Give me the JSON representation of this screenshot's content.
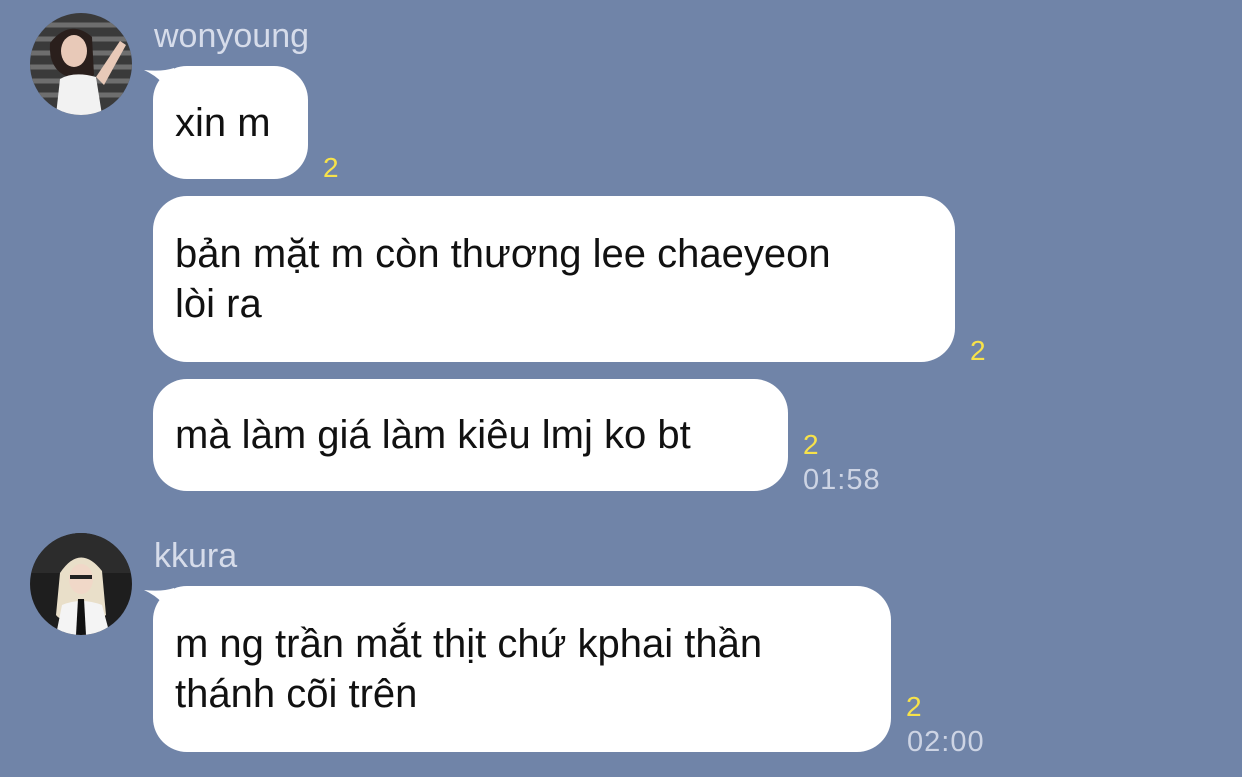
{
  "colors": {
    "background": "#7084a8",
    "bubble": "#ffffff",
    "read_count": "#f7e24a",
    "meta_text": "#cdd4e4"
  },
  "groups": [
    {
      "sender": "wonyoung",
      "avatar_icon": "profile-photo",
      "messages": [
        {
          "text": "xin m",
          "read_count": "2",
          "time": ""
        },
        {
          "text": "bản mặt m còn thương lee chaeyeon\nlòi ra",
          "read_count": "2",
          "time": ""
        },
        {
          "text": "mà làm giá làm kiêu lmj ko bt",
          "read_count": "2",
          "time": "01:58"
        }
      ]
    },
    {
      "sender": "kkura",
      "avatar_icon": "profile-photo",
      "messages": [
        {
          "text": "m ng trần mắt thịt chứ kphai thần\nthánh cõi trên",
          "read_count": "2",
          "time": "02:00"
        }
      ]
    }
  ]
}
